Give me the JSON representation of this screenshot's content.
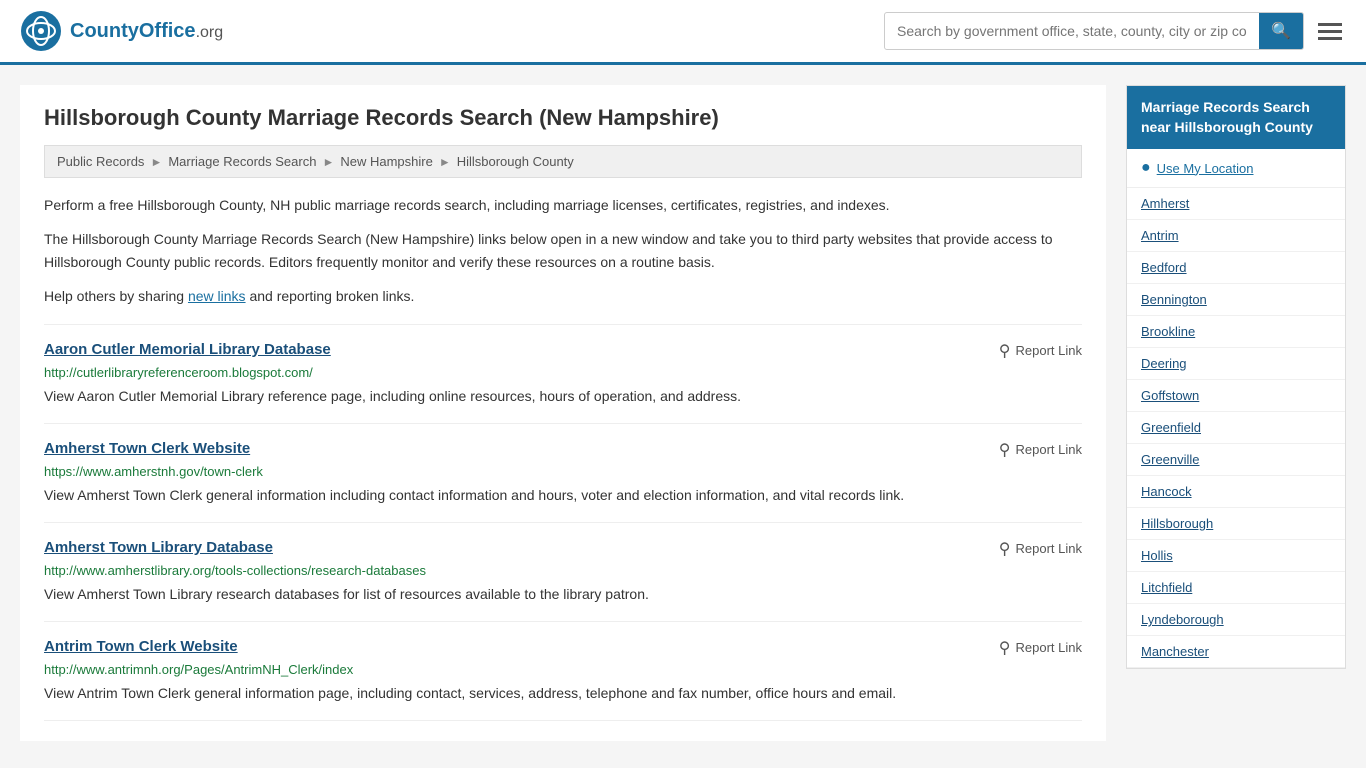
{
  "header": {
    "logo_text": "CountyOffice",
    "logo_suffix": ".org",
    "search_placeholder": "Search by government office, state, county, city or zip code",
    "search_value": ""
  },
  "page": {
    "title": "Hillsborough County Marriage Records Search (New Hampshire)"
  },
  "breadcrumb": {
    "items": [
      "Public Records",
      "Marriage Records Search",
      "New Hampshire",
      "Hillsborough County"
    ]
  },
  "description": {
    "para1": "Perform a free Hillsborough County, NH public marriage records search, including marriage licenses, certificates, registries, and indexes.",
    "para2": "The Hillsborough County Marriage Records Search (New Hampshire) links below open in a new window and take you to third party websites that provide access to Hillsborough County public records. Editors frequently monitor and verify these resources on a routine basis.",
    "para3_prefix": "Help others by sharing ",
    "new_links": "new links",
    "para3_suffix": " and reporting broken links."
  },
  "results": [
    {
      "title": "Aaron Cutler Memorial Library Database",
      "url": "http://cutlerlibraryreferenceroom.blogspot.com/",
      "desc": "View Aaron Cutler Memorial Library reference page, including online resources, hours of operation, and address.",
      "report_label": "Report Link"
    },
    {
      "title": "Amherst Town Clerk Website",
      "url": "https://www.amherstnh.gov/town-clerk",
      "desc": "View Amherst Town Clerk general information including contact information and hours, voter and election information, and vital records link.",
      "report_label": "Report Link"
    },
    {
      "title": "Amherst Town Library Database",
      "url": "http://www.amherstlibrary.org/tools-collections/research-databases",
      "desc": "View Amherst Town Library research databases for list of resources available to the library patron.",
      "report_label": "Report Link"
    },
    {
      "title": "Antrim Town Clerk Website",
      "url": "http://www.antrimnh.org/Pages/AntrimNH_Clerk/index",
      "desc": "View Antrim Town Clerk general information page, including contact, services, address, telephone and fax number, office hours and email.",
      "report_label": "Report Link"
    }
  ],
  "sidebar": {
    "header": "Marriage Records Search near Hillsborough County",
    "use_my_location": "Use My Location",
    "links": [
      "Amherst",
      "Antrim",
      "Bedford",
      "Bennington",
      "Brookline",
      "Deering",
      "Goffstown",
      "Greenfield",
      "Greenville",
      "Hancock",
      "Hillsborough",
      "Hollis",
      "Litchfield",
      "Lyndeborough",
      "Manchester"
    ]
  }
}
